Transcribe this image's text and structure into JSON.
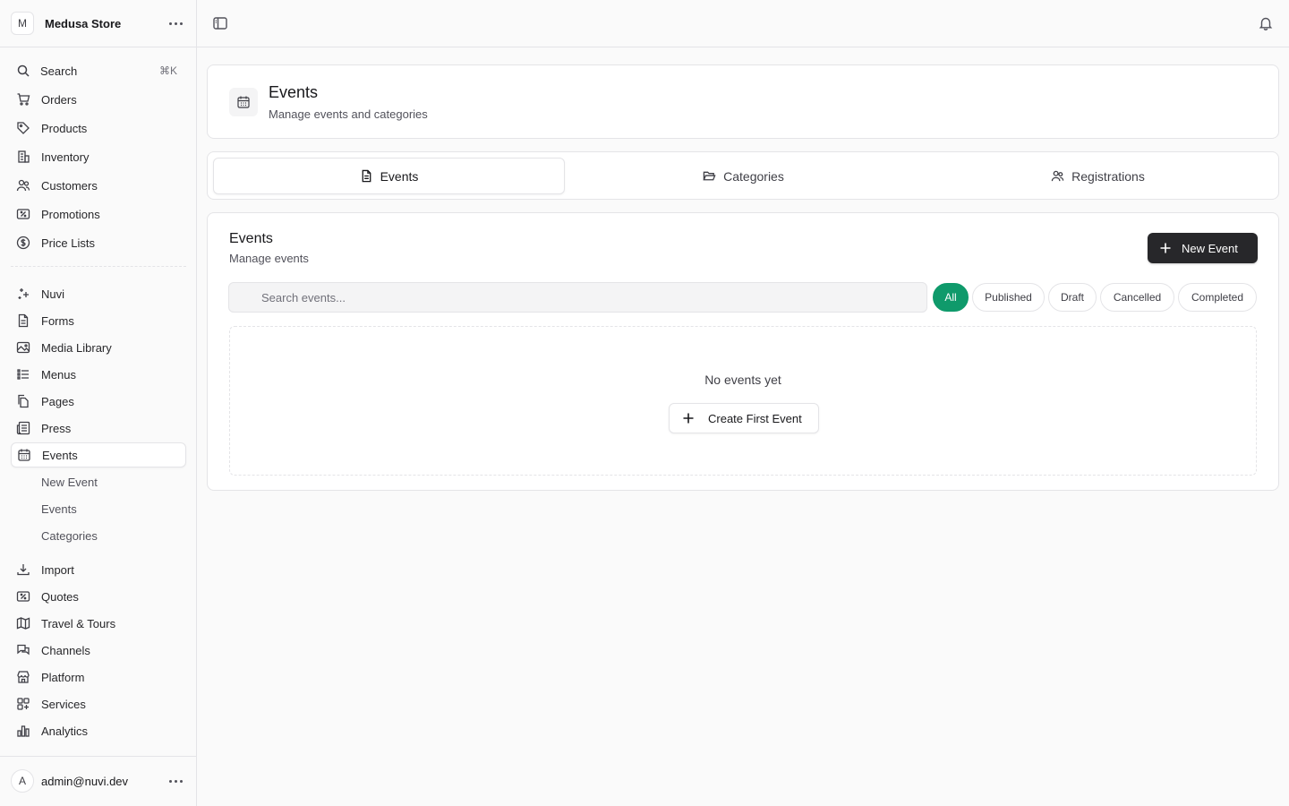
{
  "store": {
    "initial": "M",
    "name": "Medusa Store"
  },
  "search": {
    "label": "Search",
    "shortcut": "⌘K"
  },
  "sidebar": {
    "primary": [
      {
        "label": "Orders",
        "icon": "cart-icon"
      },
      {
        "label": "Products",
        "icon": "tag-icon"
      },
      {
        "label": "Inventory",
        "icon": "building-icon"
      },
      {
        "label": "Customers",
        "icon": "users-icon"
      },
      {
        "label": "Promotions",
        "icon": "receipt-percent-icon"
      },
      {
        "label": "Price Lists",
        "icon": "currency-dollar-icon"
      }
    ],
    "extensions": [
      {
        "label": "Nuvi",
        "icon": "sparkles-icon"
      },
      {
        "label": "Forms",
        "icon": "document-icon"
      },
      {
        "label": "Media Library",
        "icon": "photo-icon"
      },
      {
        "label": "Menus",
        "icon": "list-bullet-icon"
      },
      {
        "label": "Pages",
        "icon": "documents-icon"
      },
      {
        "label": "Press",
        "icon": "newspaper-icon"
      },
      {
        "label": "Events",
        "icon": "calendar-icon",
        "active": true
      }
    ],
    "events_sub": [
      {
        "label": "New Event"
      },
      {
        "label": "Events"
      },
      {
        "label": "Categories"
      }
    ],
    "more": [
      {
        "label": "Import",
        "icon": "arrow-down-tray-icon"
      },
      {
        "label": "Quotes",
        "icon": "receipt-percent-icon"
      },
      {
        "label": "Travel & Tours",
        "icon": "map-icon"
      },
      {
        "label": "Channels",
        "icon": "chat-bubbles-icon"
      },
      {
        "label": "Platform",
        "icon": "building-storefront-icon"
      },
      {
        "label": "Services",
        "icon": "squares-plus-icon"
      },
      {
        "label": "Analytics",
        "icon": "chart-bar-icon"
      }
    ]
  },
  "user": {
    "initial": "A",
    "email": "admin@nuvi.dev"
  },
  "header": {
    "title": "Events",
    "subtitle": "Manage events and categories"
  },
  "tabs": [
    {
      "label": "Events",
      "icon": "document-icon",
      "active": true
    },
    {
      "label": "Categories",
      "icon": "folder-open-icon"
    },
    {
      "label": "Registrations",
      "icon": "users-icon"
    }
  ],
  "events_list": {
    "title": "Events",
    "subtitle": "Manage events",
    "new_button": "New Event",
    "search_placeholder": "Search events...",
    "filters": [
      "All",
      "Published",
      "Draft",
      "Cancelled",
      "Completed"
    ],
    "active_filter": "All",
    "empty_text": "No events yet",
    "create_button": "Create First Event"
  },
  "colors": {
    "accent": "#0f9a6b",
    "primary_button": "#27272a"
  }
}
